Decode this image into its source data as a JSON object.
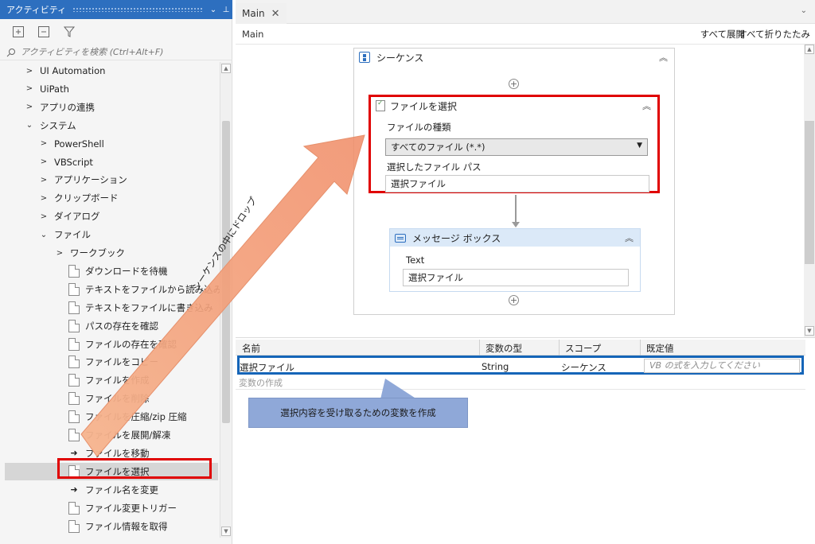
{
  "panel": {
    "title": "アクティビティ",
    "search_placeholder": "アクティビティを検索 (Ctrl+Alt+F)"
  },
  "tree": [
    {
      "label": "UI Automation",
      "indent": 0,
      "chev": "›"
    },
    {
      "label": "UiPath",
      "indent": 0,
      "chev": "›"
    },
    {
      "label": "アプリの連携",
      "indent": 0,
      "chev": "›"
    },
    {
      "label": "システム",
      "indent": 0,
      "chev": "⌄"
    },
    {
      "label": "PowerShell",
      "indent": 1,
      "chev": "›"
    },
    {
      "label": "VBScript",
      "indent": 1,
      "chev": "›"
    },
    {
      "label": "アプリケーション",
      "indent": 1,
      "chev": "›"
    },
    {
      "label": "クリップボード",
      "indent": 1,
      "chev": "›"
    },
    {
      "label": "ダイアログ",
      "indent": 1,
      "chev": "›"
    },
    {
      "label": "ファイル",
      "indent": 1,
      "chev": "⌄"
    },
    {
      "label": "ワークブック",
      "indent": 2,
      "chev": "›"
    },
    {
      "label": "ダウンロードを待機",
      "indent": 3,
      "icon": "file"
    },
    {
      "label": "テキストをファイルから読み込み",
      "indent": 3,
      "icon": "file"
    },
    {
      "label": "テキストをファイルに書き込み",
      "indent": 3,
      "icon": "file"
    },
    {
      "label": "パスの存在を確認",
      "indent": 3,
      "icon": "file"
    },
    {
      "label": "ファイルの存在を確認",
      "indent": 3,
      "icon": "file"
    },
    {
      "label": "ファイルをコピー",
      "indent": 3,
      "icon": "file"
    },
    {
      "label": "ファイルを作成",
      "indent": 3,
      "icon": "file"
    },
    {
      "label": "ファイルを削除",
      "indent": 3,
      "icon": "file"
    },
    {
      "label": "ファイルを圧縮/zip 圧縮",
      "indent": 3,
      "icon": "file"
    },
    {
      "label": "ファイルを展開/解凍",
      "indent": 3,
      "icon": "file"
    },
    {
      "label": "ファイルを移動",
      "indent": 3,
      "icon": "arrow"
    },
    {
      "label": "ファイルを選択",
      "indent": 3,
      "icon": "file",
      "selected": true
    },
    {
      "label": "ファイル名を変更",
      "indent": 3,
      "icon": "arrow"
    },
    {
      "label": "ファイル変更トリガー",
      "indent": 3,
      "icon": "file"
    },
    {
      "label": "ファイル情報を取得",
      "indent": 3,
      "icon": "file"
    }
  ],
  "designer": {
    "tab_label": "Main",
    "breadcrumb": "Main",
    "expand_all": "すべて展開",
    "collapse_all": "すべて折りたたみ",
    "sequence_title": "シーケンス",
    "select_file": {
      "title": "ファイルを選択",
      "file_type_label": "ファイルの種類",
      "file_type_value": "すべてのファイル (*.*)",
      "path_label": "選択したファイル パス",
      "path_value": "選択ファイル"
    },
    "message_box": {
      "title": "メッセージ ボックス",
      "text_label": "Text",
      "text_value": "選択ファイル"
    }
  },
  "annotation": {
    "drag_text": "シーケンスの中にドロップ",
    "callout_text": "選択内容を受け取るための変数を作成"
  },
  "variables": {
    "headers": {
      "name": "名前",
      "type": "変数の型",
      "scope": "スコープ",
      "default": "既定値"
    },
    "row": {
      "name": "選択ファイル",
      "type": "String",
      "scope": "シーケンス",
      "default_placeholder": "VB の式を入力してください"
    },
    "create_label": "変数の作成"
  },
  "colors": {
    "accent": "#2d6fbf",
    "highlight_red": "#e00000",
    "highlight_blue": "#1565b8",
    "arrow_orange": "#f3a582",
    "callout_blue": "#8fa8d8"
  }
}
